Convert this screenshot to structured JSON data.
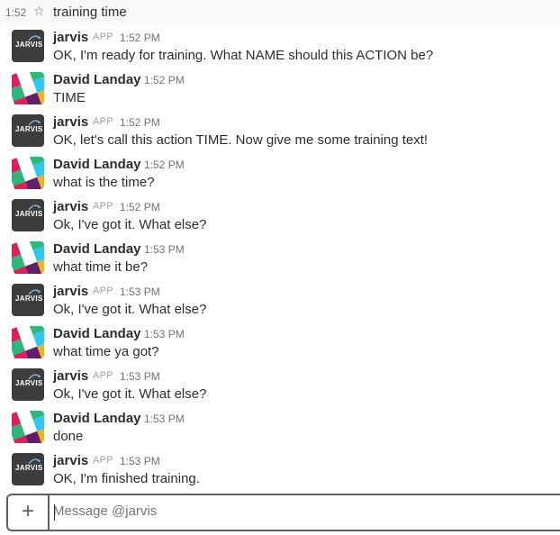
{
  "header": {
    "time": "1:52",
    "title": "training time"
  },
  "messages": [
    {
      "sender": "jarvis",
      "app": "APP",
      "time": "1:52 PM",
      "text": "OK, I'm ready for training. What NAME should this ACTION be?",
      "avatar": "jarvis-logo"
    },
    {
      "sender": "David Landay",
      "time": "1:52 PM",
      "text": "TIME",
      "avatar": "slack-style-avatar"
    },
    {
      "sender": "jarvis",
      "app": "APP",
      "time": "1:52 PM",
      "text": "OK, let's call this action TIME. Now give me some training text!",
      "avatar": "jarvis-logo"
    },
    {
      "sender": "David Landay",
      "time": "1:52 PM",
      "text": "what is the time?",
      "avatar": "slack-style-avatar"
    },
    {
      "sender": "jarvis",
      "app": "APP",
      "time": "1:52 PM",
      "text": "Ok, I've got it. What else?",
      "avatar": "jarvis-logo"
    },
    {
      "sender": "David Landay",
      "time": "1:53 PM",
      "text": "what time it be?",
      "avatar": "slack-style-avatar"
    },
    {
      "sender": "jarvis",
      "app": "APP",
      "time": "1:53 PM",
      "text": "Ok, I've got it. What else?",
      "avatar": "jarvis-logo"
    },
    {
      "sender": "David Landay",
      "time": "1:53 PM",
      "text": "what time ya got?",
      "avatar": "slack-style-avatar"
    },
    {
      "sender": "jarvis",
      "app": "APP",
      "time": "1:53 PM",
      "text": "Ok, I've got it. What else?",
      "avatar": "jarvis-logo"
    },
    {
      "sender": "David Landay",
      "time": "1:53 PM",
      "text": "done",
      "avatar": "slack-style-avatar"
    },
    {
      "sender": "jarvis",
      "app": "APP",
      "time": "1:53 PM",
      "text": "OK, I'm finished training.",
      "avatar": "jarvis-logo"
    }
  ],
  "jarvis_logo_text": "JARVIS",
  "composer": {
    "plus": "+",
    "placeholder": "Message @jarvis"
  },
  "colors": {
    "text": "#2c2d30",
    "muted": "#717274",
    "app_badge": "#9e9ea6",
    "jarvis_avatar_bg": "#3d3d3f"
  }
}
